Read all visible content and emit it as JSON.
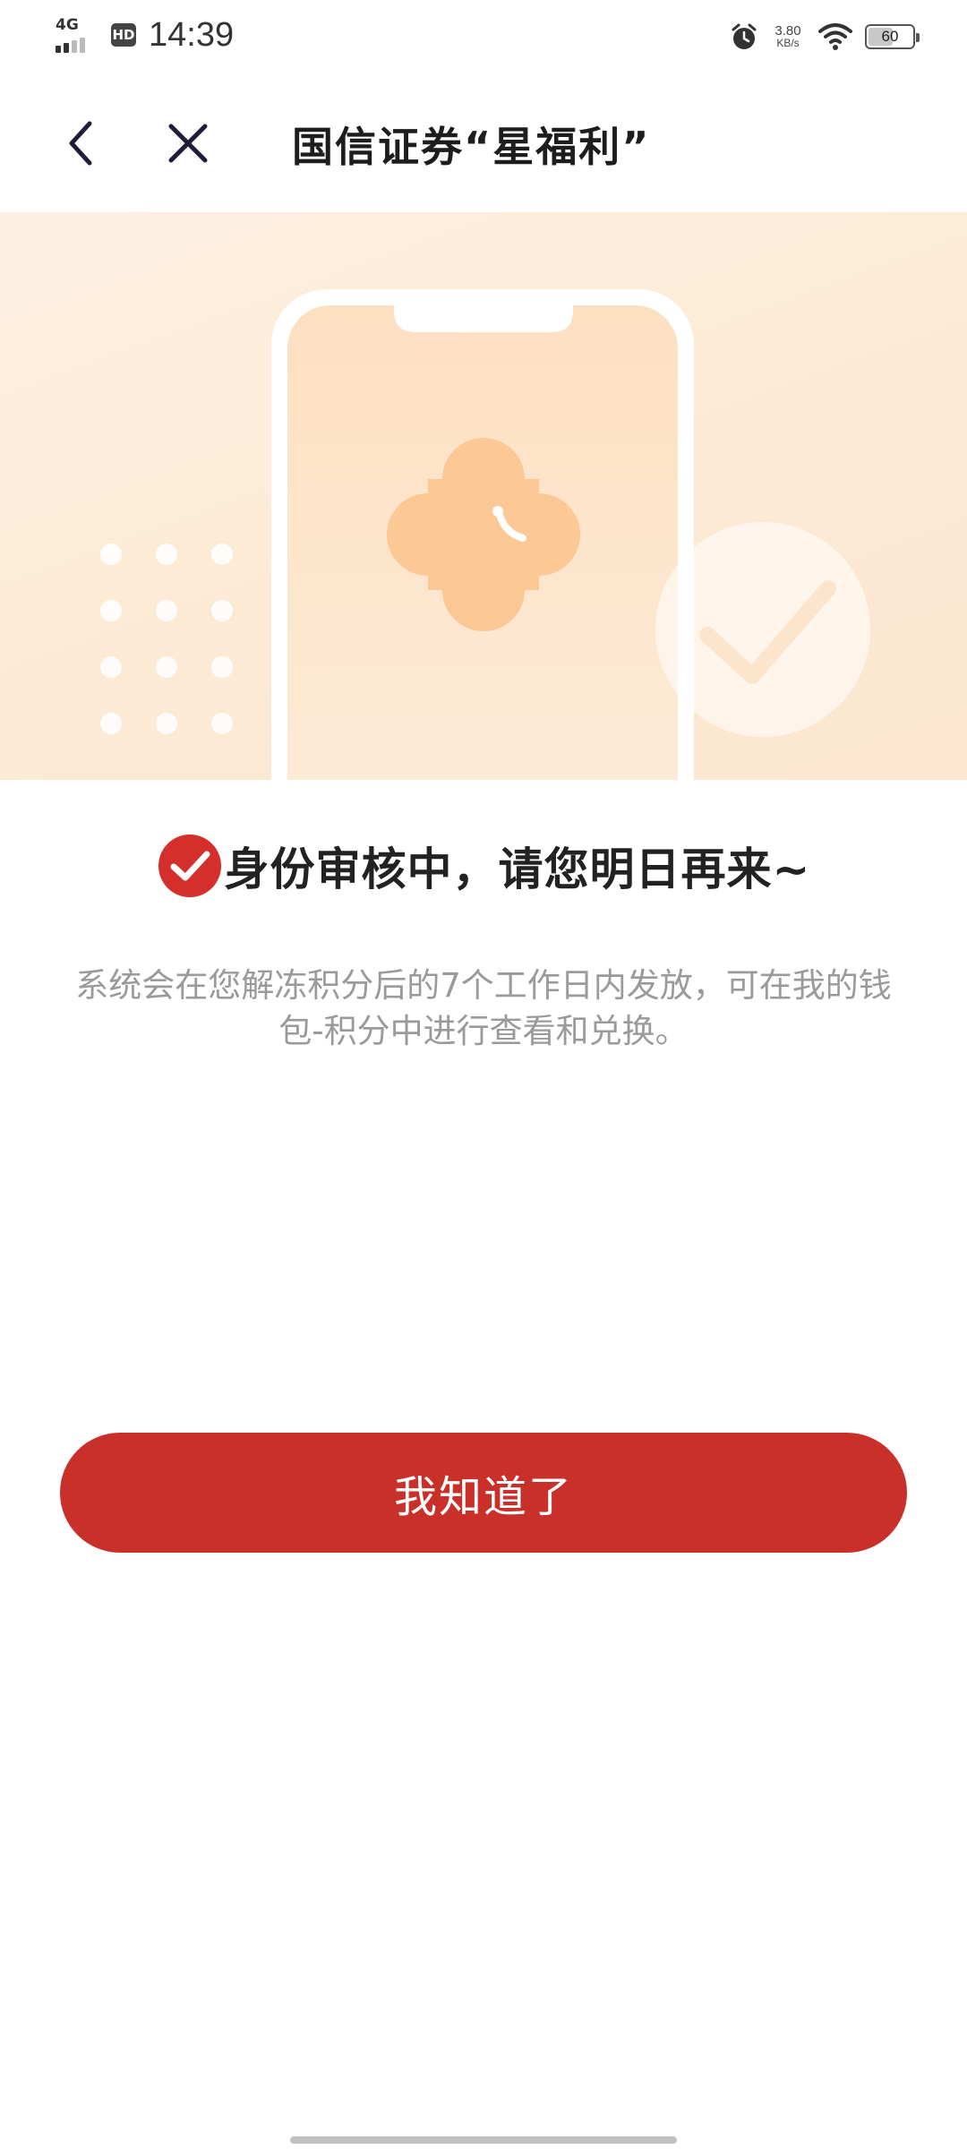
{
  "status_bar": {
    "network": "4G",
    "hd_badge": "HD",
    "time": "14:39",
    "speed_value": "3.80",
    "speed_unit": "KB/s",
    "battery_level": "60",
    "battery_percent": 60
  },
  "nav": {
    "title": "国信证券“星福利”",
    "back_icon": "chevron-left-icon",
    "close_icon": "close-icon"
  },
  "banner": {
    "illustration": "phone-with-clover-and-check",
    "colors": {
      "background": "#fdebd6",
      "clover": "#fcc896"
    }
  },
  "result": {
    "icon": "check-badge-icon",
    "title": "身份审核中，请您明日再来~",
    "description": "系统会在您解冻积分后的7个工作日内发放，可在我的钱包-积分中进行查看和兑换。"
  },
  "actions": {
    "confirm_label": "我知道了"
  },
  "colors": {
    "accent": "#c9302a",
    "title_text": "#222222",
    "description_text": "#9a9a9a"
  }
}
